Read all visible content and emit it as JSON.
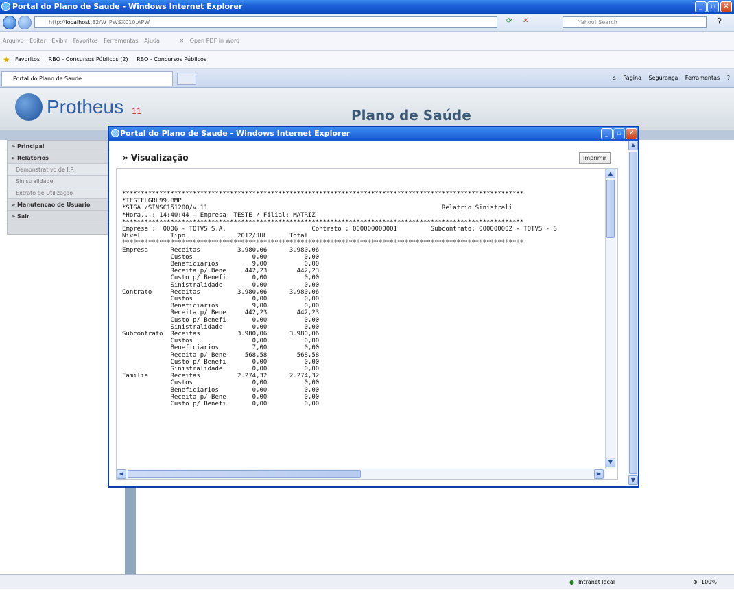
{
  "window": {
    "title": "Portal do Plano de Saude - Windows Internet Explorer"
  },
  "address_bar": {
    "url_prefix": "http://",
    "url_host": "localhost",
    "url_path": ":82/W_PWSX010.APW",
    "search_placeholder": "Yahoo! Search"
  },
  "menu": {
    "items": [
      "Arquivo",
      "Editar",
      "Exibir",
      "Favoritos",
      "Ferramentas",
      "Ajuda"
    ],
    "pdf_label": "Open PDF in Word"
  },
  "favorites": {
    "label": "Favoritos",
    "links": [
      "RBO - Concursos Públicos (2)",
      "RBO - Concursos Públicos"
    ]
  },
  "tab": {
    "label": "Portal do Plano de Saude"
  },
  "command_bar": {
    "page": "Página",
    "security": "Segurança",
    "tools": "Ferramentas"
  },
  "header": {
    "logo": "Protheus",
    "version": "11",
    "title": "Plano de Saúde"
  },
  "sidebar": {
    "items": [
      {
        "label": "» Principal",
        "type": "main"
      },
      {
        "label": "» Relatorios",
        "type": "main"
      },
      {
        "label": "Demonstrativo de I.R",
        "type": "sub"
      },
      {
        "label": "Sinistralidade",
        "type": "sub"
      },
      {
        "label": "Extrato de Utilização",
        "type": "sub"
      },
      {
        "label": "» Manutencao de Usuario",
        "type": "main"
      },
      {
        "label": "» Sair",
        "type": "main"
      }
    ]
  },
  "popup": {
    "title": "Portal do Plano de Saude - Windows Internet Explorer",
    "section_title": "» Visualização",
    "print_label": "Imprimir"
  },
  "report": {
    "lines": [
      "************************************************************************************************************",
      "*TESTELGRL99.BMP",
      "*SIGA /SINSC151200/v.11                                                               Relatrio Sinistrali",
      "*Hora...: 14:40:44 - Empresa: TESTE / Filial: MATRIZ",
      "************************************************************************************************************",
      "Empresa :  0006 - TOTVS S.A.                       Contrato : 000000000001         Subcontrato: 000000002 - TOTVS - S",
      "Nivel        Tipo              2012/JUL      Total",
      "************************************************************************************************************",
      "Empresa      Receitas          3.980,06      3.980,06",
      "             Custos                0,00          0,00",
      "             Beneficiarios         9,00          0,00",
      "             Receita p/ Bene     442,23        442,23",
      "             Custo p/ Benefi       0,00          0,00",
      "             Sinistralidade        0,00          0,00",
      "Contrato     Receitas          3.980,06      3.980,06",
      "             Custos                0,00          0,00",
      "             Beneficiarios         9,00          0,00",
      "             Receita p/ Bene     442,23        442,23",
      "             Custo p/ Benefi       0,00          0,00",
      "             Sinistralidade        0,00          0,00",
      "Subcontrato  Receitas          3.980,06      3.980,06",
      "             Custos                0,00          0,00",
      "             Beneficiarios         7,00          0,00",
      "             Receita p/ Bene     568,58        568,58",
      "             Custo p/ Benefi       0,00          0,00",
      "             Sinistralidade        0,00          0,00",
      "Familia      Receitas          2.274,32      2.274,32",
      "             Custos                0,00          0,00",
      "             Beneficiarios         0,00          0,00",
      "             Receita p/ Bene       0,00          0,00",
      "             Custo p/ Benefi       0,00          0,00"
    ]
  },
  "status": {
    "zone": "Intranet local",
    "zoom": "100%"
  }
}
